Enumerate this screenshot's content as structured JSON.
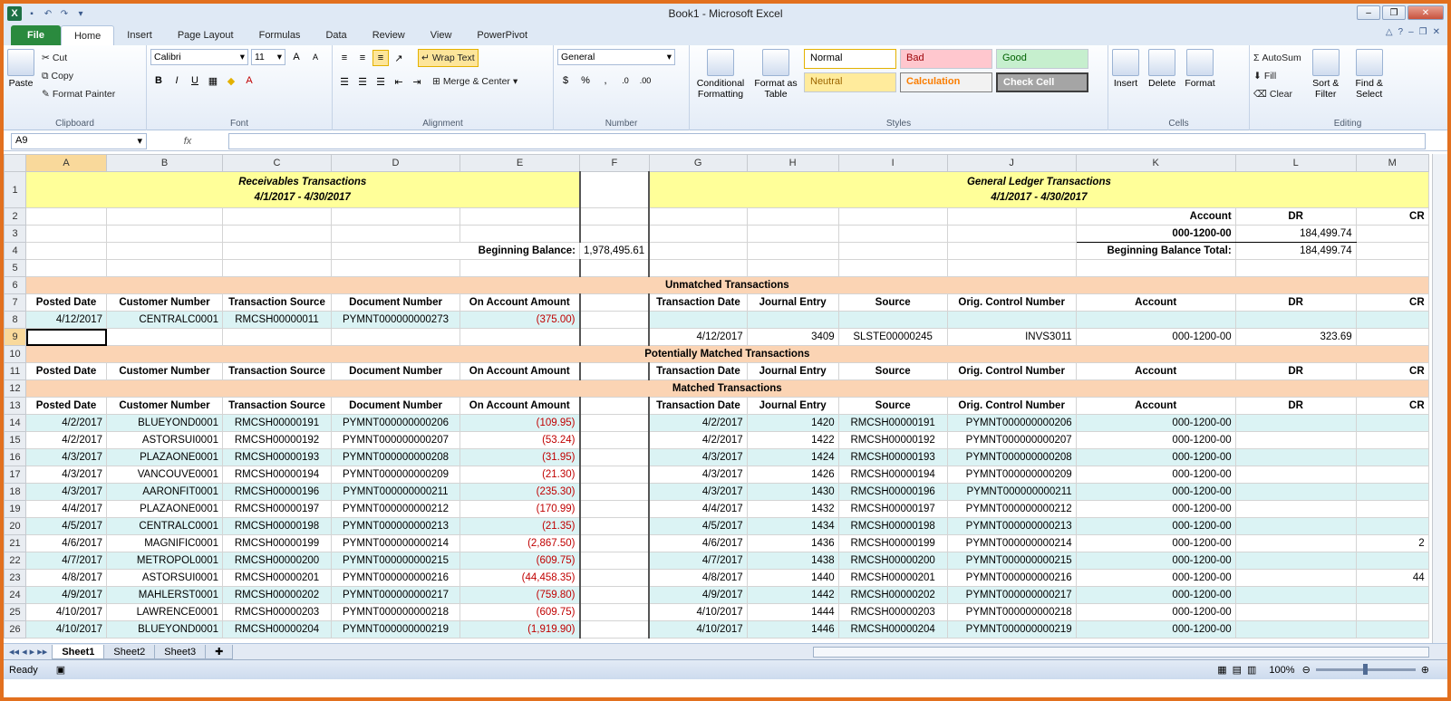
{
  "window": {
    "title": "Book1 - Microsoft Excel"
  },
  "tabs": [
    "File",
    "Home",
    "Insert",
    "Page Layout",
    "Formulas",
    "Data",
    "Review",
    "View",
    "PowerPivot"
  ],
  "ribbon": {
    "clipboard": {
      "paste": "Paste",
      "cut": "Cut",
      "copy": "Copy",
      "format_painter": "Format Painter",
      "label": "Clipboard"
    },
    "font": {
      "name": "Calibri",
      "size": "11",
      "label": "Font"
    },
    "alignment": {
      "wrap": "Wrap Text",
      "merge": "Merge & Center",
      "label": "Alignment"
    },
    "number": {
      "format": "General",
      "label": "Number"
    },
    "styles": {
      "conditional": "Conditional Formatting",
      "table": "Format as Table",
      "normal": "Normal",
      "bad": "Bad",
      "good": "Good",
      "neutral": "Neutral",
      "calculation": "Calculation",
      "check": "Check Cell",
      "label": "Styles"
    },
    "cells": {
      "insert": "Insert",
      "delete": "Delete",
      "format": "Format",
      "label": "Cells"
    },
    "editing": {
      "autosum": "AutoSum",
      "fill": "Fill",
      "clear": "Clear",
      "sort": "Sort & Filter",
      "find": "Find & Select",
      "label": "Editing"
    }
  },
  "formula_bar": {
    "name_box": "A9",
    "fx": "fx",
    "content": ""
  },
  "columns": [
    "A",
    "B",
    "C",
    "D",
    "E",
    "F",
    "G",
    "H",
    "I",
    "J",
    "K",
    "L",
    "M"
  ],
  "sheet": {
    "ar_title": "Receivables Transactions",
    "ar_dates": "4/1/2017 - 4/30/2017",
    "gl_title": "General Ledger Transactions",
    "gl_dates": "4/1/2017 - 4/30/2017",
    "account_hdr": "Account",
    "dr_hdr": "DR",
    "cr_hdr": "CR",
    "acct": "000-1200-00",
    "acct_dr": "184,499.74",
    "beg_bal_label": "Beginning Balance:",
    "beg_bal": "1,978,495.61",
    "beg_total_label": "Beginning Balance Total:",
    "beg_total": "184,499.74",
    "unmatched": "Unmatched Transactions",
    "potential": "Potentially Matched Transactions",
    "matched": "Matched Transactions",
    "ar_headers": [
      "Posted Date",
      "Customer Number",
      "Transaction Source",
      "Document Number",
      "On Account Amount"
    ],
    "gl_headers": [
      "Transaction Date",
      "Journal Entry",
      "Source",
      "Orig. Control Number",
      "Account",
      "DR",
      "CR"
    ],
    "unmatched_ar": [
      "4/12/2017",
      "CENTRALC0001",
      "RMCSH00000011",
      "PYMNT000000000273",
      "(375.00)"
    ],
    "unmatched_gl": [
      "4/12/2017",
      "3409",
      "SLSTE00000245",
      "INVS3011",
      "000-1200-00",
      "323.69"
    ],
    "matched_rows": [
      [
        "4/2/2017",
        "BLUEYOND0001",
        "RMCSH00000191",
        "PYMNT000000000206",
        "(109.95)",
        "4/2/2017",
        "1420",
        "RMCSH00000191",
        "PYMNT000000000206",
        "000-1200-00",
        "",
        ""
      ],
      [
        "4/2/2017",
        "ASTORSUI0001",
        "RMCSH00000192",
        "PYMNT000000000207",
        "(53.24)",
        "4/2/2017",
        "1422",
        "RMCSH00000192",
        "PYMNT000000000207",
        "000-1200-00",
        "",
        ""
      ],
      [
        "4/3/2017",
        "PLAZAONE0001",
        "RMCSH00000193",
        "PYMNT000000000208",
        "(31.95)",
        "4/3/2017",
        "1424",
        "RMCSH00000193",
        "PYMNT000000000208",
        "000-1200-00",
        "",
        ""
      ],
      [
        "4/3/2017",
        "VANCOUVE0001",
        "RMCSH00000194",
        "PYMNT000000000209",
        "(21.30)",
        "4/3/2017",
        "1426",
        "RMCSH00000194",
        "PYMNT000000000209",
        "000-1200-00",
        "",
        ""
      ],
      [
        "4/3/2017",
        "AARONFIT0001",
        "RMCSH00000196",
        "PYMNT000000000211",
        "(235.30)",
        "4/3/2017",
        "1430",
        "RMCSH00000196",
        "PYMNT000000000211",
        "000-1200-00",
        "",
        ""
      ],
      [
        "4/4/2017",
        "PLAZAONE0001",
        "RMCSH00000197",
        "PYMNT000000000212",
        "(170.99)",
        "4/4/2017",
        "1432",
        "RMCSH00000197",
        "PYMNT000000000212",
        "000-1200-00",
        "",
        ""
      ],
      [
        "4/5/2017",
        "CENTRALC0001",
        "RMCSH00000198",
        "PYMNT000000000213",
        "(21.35)",
        "4/5/2017",
        "1434",
        "RMCSH00000198",
        "PYMNT000000000213",
        "000-1200-00",
        "",
        ""
      ],
      [
        "4/6/2017",
        "MAGNIFIC0001",
        "RMCSH00000199",
        "PYMNT000000000214",
        "(2,867.50)",
        "4/6/2017",
        "1436",
        "RMCSH00000199",
        "PYMNT000000000214",
        "000-1200-00",
        "",
        "2"
      ],
      [
        "4/7/2017",
        "METROPOL0001",
        "RMCSH00000200",
        "PYMNT000000000215",
        "(609.75)",
        "4/7/2017",
        "1438",
        "RMCSH00000200",
        "PYMNT000000000215",
        "000-1200-00",
        "",
        ""
      ],
      [
        "4/8/2017",
        "ASTORSUI0001",
        "RMCSH00000201",
        "PYMNT000000000216",
        "(44,458.35)",
        "4/8/2017",
        "1440",
        "RMCSH00000201",
        "PYMNT000000000216",
        "000-1200-00",
        "",
        "44"
      ],
      [
        "4/9/2017",
        "MAHLERST0001",
        "RMCSH00000202",
        "PYMNT000000000217",
        "(759.80)",
        "4/9/2017",
        "1442",
        "RMCSH00000202",
        "PYMNT000000000217",
        "000-1200-00",
        "",
        ""
      ],
      [
        "4/10/2017",
        "LAWRENCE0001",
        "RMCSH00000203",
        "PYMNT000000000218",
        "(609.75)",
        "4/10/2017",
        "1444",
        "RMCSH00000203",
        "PYMNT000000000218",
        "000-1200-00",
        "",
        ""
      ],
      [
        "4/10/2017",
        "BLUEYOND0001",
        "RMCSH00000204",
        "PYMNT000000000219",
        "(1,919.90)",
        "4/10/2017",
        "1446",
        "RMCSH00000204",
        "PYMNT000000000219",
        "000-1200-00",
        "",
        ""
      ]
    ]
  },
  "sheet_tabs": [
    "Sheet1",
    "Sheet2",
    "Sheet3"
  ],
  "status": {
    "ready": "Ready",
    "zoom": "100%"
  }
}
